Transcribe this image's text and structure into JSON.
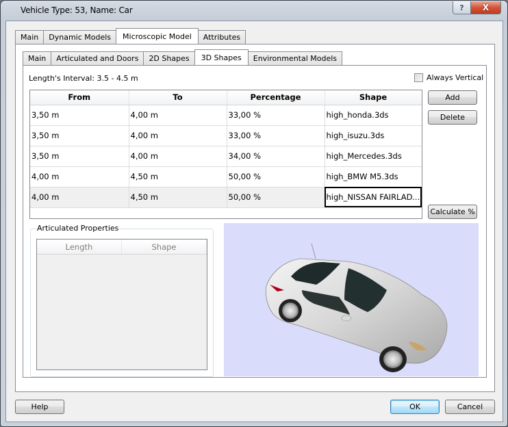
{
  "window": {
    "title": "Vehicle Type: 53, Name: Car",
    "help_caption": "?",
    "close_caption": "X"
  },
  "outer_tabs": [
    {
      "label": "Main",
      "active": false
    },
    {
      "label": "Dynamic Models",
      "active": false
    },
    {
      "label": "Microscopic Model",
      "active": true
    },
    {
      "label": "Attributes",
      "active": false
    }
  ],
  "inner_tabs": [
    {
      "label": "Main",
      "active": false
    },
    {
      "label": "Articulated and Doors",
      "active": false
    },
    {
      "label": "2D Shapes",
      "active": false
    },
    {
      "label": "3D Shapes",
      "active": true
    },
    {
      "label": "Environmental Models",
      "active": false
    }
  ],
  "shapes": {
    "interval_label": "Length's Interval: 3.5 - 4.5 m",
    "always_vertical_label": "Always Vertical",
    "always_vertical_checked": false,
    "columns": [
      "From",
      "To",
      "Percentage",
      "Shape"
    ],
    "rows": [
      {
        "from": "3,50 m",
        "to": "4,00 m",
        "percentage": "33,00 %",
        "shape": "high_honda.3ds"
      },
      {
        "from": "3,50 m",
        "to": "4,00 m",
        "percentage": "33,00 %",
        "shape": "high_isuzu.3ds"
      },
      {
        "from": "3,50 m",
        "to": "4,00 m",
        "percentage": "34,00 %",
        "shape": "high_Mercedes.3ds"
      },
      {
        "from": "4,00 m",
        "to": "4,50 m",
        "percentage": "50,00 %",
        "shape": "high_BMW M5.3ds"
      },
      {
        "from": "4,00 m",
        "to": "4,50 m",
        "percentage": "50,00 %",
        "shape": "high_NISSAN FAIRLADY..."
      }
    ],
    "selected_row": 4,
    "add_label": "Add",
    "delete_label": "Delete",
    "calculate_label": "Calculate %"
  },
  "articulated": {
    "legend": "Articulated Properties",
    "columns": [
      "Length",
      "Shape"
    ]
  },
  "preview": {
    "background": "#dadcfb",
    "model_description": "silver sports coupe 3D model"
  },
  "footer": {
    "help_label": "Help",
    "ok_label": "OK",
    "cancel_label": "Cancel"
  }
}
